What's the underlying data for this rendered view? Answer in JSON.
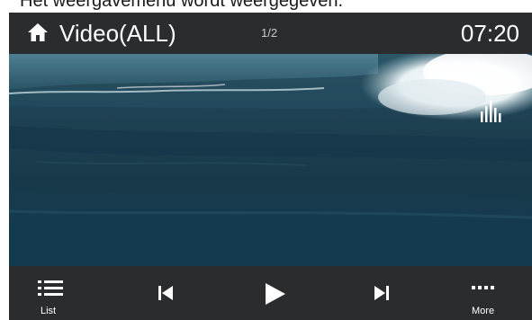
{
  "caption": "Het weergavemenu wordt weergegeven.",
  "header": {
    "home_icon": "home-icon",
    "title": "Video(ALL)",
    "page_indicator": "1/2",
    "clock": "07:20"
  },
  "player": {
    "eq_icon": "equalizer-icon"
  },
  "controls": {
    "list_label": "List",
    "more_label": "More",
    "list_icon": "list-icon",
    "prev_icon": "skip-previous-icon",
    "play_icon": "play-icon",
    "next_icon": "skip-next-icon",
    "more_icon": "more-dots-icon"
  },
  "colors": {
    "bar_background": "#2b2c2e",
    "text": "#ffffff",
    "water": "#1d3b4d"
  }
}
